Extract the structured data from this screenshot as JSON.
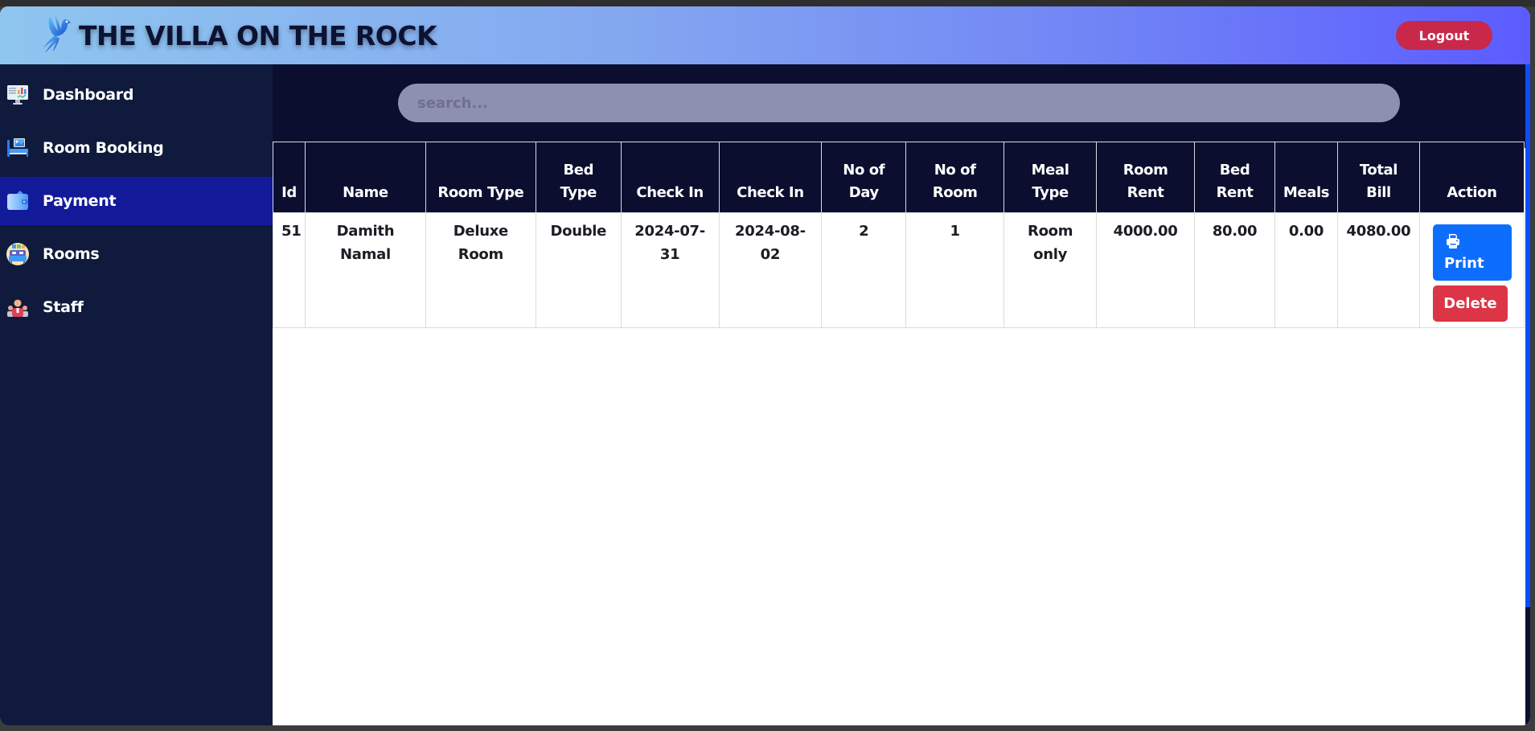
{
  "header": {
    "title": "THE VILLA ON THE ROCK",
    "logo_icon": "bird-logo-icon",
    "logout_label": "Logout"
  },
  "sidebar": {
    "items": [
      {
        "label": "Dashboard",
        "icon": "monitor-chart-icon",
        "active": false
      },
      {
        "label": "Room Booking",
        "icon": "bed-booking-icon",
        "active": false
      },
      {
        "label": "Payment",
        "icon": "wallet-icon",
        "active": true
      },
      {
        "label": "Rooms",
        "icon": "room-bed-icon",
        "active": false
      },
      {
        "label": "Staff",
        "icon": "staff-people-icon",
        "active": false
      }
    ]
  },
  "search": {
    "placeholder": "search...",
    "value": ""
  },
  "table": {
    "headers": [
      "Id",
      "Name",
      "Room Type",
      "Bed Type",
      "Check In",
      "Check In",
      "No of Day",
      "No of Room",
      "Meal Type",
      "Room Rent",
      "Bed Rent",
      "Meals",
      "Total Bill",
      "Action"
    ],
    "rows": [
      {
        "id": "51",
        "name": "Damith Namal",
        "room_type": "Deluxe Room",
        "bed_type": "Double",
        "check_in": "2024-07-31",
        "check_out": "2024-08-02",
        "no_of_day": "2",
        "no_of_room": "1",
        "meal_type": "Room only",
        "room_rent": "4000.00",
        "bed_rent": "80.00",
        "meals": "0.00",
        "total_bill": "4080.00",
        "print_label": "Print",
        "delete_label": "Delete"
      }
    ]
  },
  "colors": {
    "header_gradient_start": "#8fc6ef",
    "header_gradient_end": "#5b5cff",
    "sidebar_bg": "#0f1a3c",
    "sidebar_active": "#131a9a",
    "main_dark": "#0b0e2e",
    "logout": "#c9284a",
    "print": "#0d6efd",
    "delete": "#dc3545"
  }
}
